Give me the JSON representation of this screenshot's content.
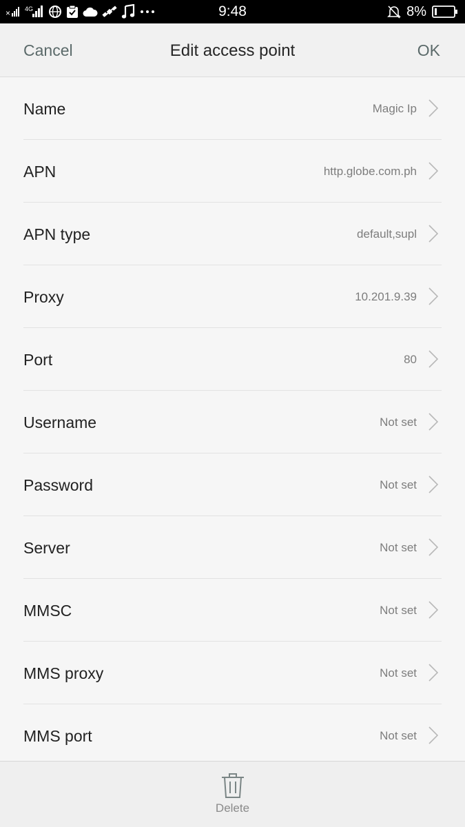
{
  "status_bar": {
    "time": "9:48",
    "battery_percent": "8%",
    "network_label": "4G",
    "icons": [
      "signal-icon",
      "4g-signal-icon",
      "globe-icon",
      "clipboard-check-icon",
      "cloud-icon",
      "satellite-icon",
      "music-note-icon",
      "more-dots-icon",
      "bell-off-icon",
      "battery-icon"
    ]
  },
  "header": {
    "cancel_label": "Cancel",
    "title": "Edit access point",
    "ok_label": "OK"
  },
  "fields": [
    {
      "label": "Name",
      "value": "Magic Ip"
    },
    {
      "label": "APN",
      "value": "http.globe.com.ph"
    },
    {
      "label": "APN type",
      "value": "default,supl"
    },
    {
      "label": "Proxy",
      "value": "10.201.9.39"
    },
    {
      "label": "Port",
      "value": "80"
    },
    {
      "label": "Username",
      "value": "Not set"
    },
    {
      "label": "Password",
      "value": "Not set"
    },
    {
      "label": "Server",
      "value": "Not set"
    },
    {
      "label": "MMSC",
      "value": "Not set"
    },
    {
      "label": "MMS proxy",
      "value": "Not set"
    },
    {
      "label": "MMS port",
      "value": "Not set"
    }
  ],
  "footer": {
    "delete_label": "Delete"
  },
  "colors": {
    "header_action": "#5b6a6a",
    "value_text": "#7d7d7d",
    "background": "#f6f6f6"
  }
}
